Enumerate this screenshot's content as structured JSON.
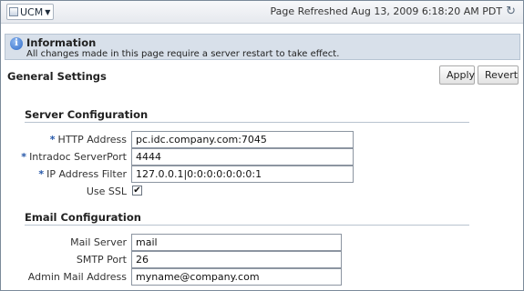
{
  "topbar": {
    "app_menu_label": "UCM",
    "refresh_text": "Page Refreshed Aug 13, 2009 6:18:20 AM PDT"
  },
  "info": {
    "title": "Information",
    "message": "All changes made in this page require a server restart to take effect."
  },
  "page": {
    "section_title": "General Settings",
    "apply_label": "Apply",
    "revert_label": "Revert"
  },
  "server_config": {
    "title": "Server Configuration",
    "fields": [
      {
        "label": "HTTP Address",
        "value": "pc.idc.company.com:7045",
        "required": true
      },
      {
        "label": "Intradoc ServerPort",
        "value": "4444",
        "required": true
      },
      {
        "label": "IP Address Filter",
        "value": "127.0.0.1|0:0:0:0:0:0:0:1",
        "required": true
      }
    ],
    "use_ssl_label": "Use SSL",
    "use_ssl_checked": true,
    "required_marker": "*",
    "check_mark": "✔"
  },
  "email_config": {
    "title": "Email Configuration",
    "fields": [
      {
        "label": "Mail Server",
        "value": "mail"
      },
      {
        "label": "SMTP Port",
        "value": "26"
      },
      {
        "label": "Admin Mail Address",
        "value": "myname@company.com"
      }
    ]
  },
  "icons": {
    "refresh": "refresh-icon",
    "info": "info-icon",
    "app_menu_caret": "chevron-down-icon"
  }
}
